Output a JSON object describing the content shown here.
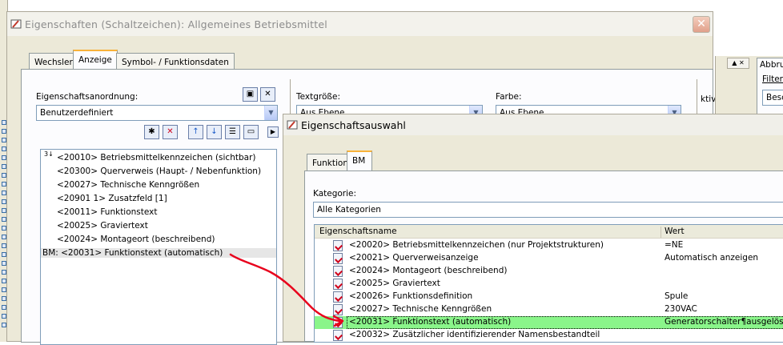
{
  "main_dialog": {
    "title": "Eigenschaften (Schaltzeichen): Allgemeines Betriebsmittel",
    "tabs": [
      {
        "label": "Wechsler",
        "active": false
      },
      {
        "label": "Anzeige",
        "active": true
      },
      {
        "label": "Symbol- / Funktionsdaten",
        "active": false
      }
    ],
    "arrangement_label": "Eigenschaftsanordnung:",
    "arrangement_value": "Benutzerdefiniert",
    "textsize_label": "Textgröße:",
    "textsize_value": "Aus Ebene",
    "color_label": "Farbe:",
    "color_value": "Aus Ebene",
    "partial_right_label": "ktiv",
    "properties": [
      "<20010> Betriebsmittelkennzeichen (sichtbar)",
      "<20300> Querverweis (Haupt- / Nebenfunktion)",
      "<20027> Technische Kenngrößen",
      "<20901 1> Zusatzfeld [1]",
      "<20011> Funktionstext",
      "<20025> Graviertext",
      "<20024> Montageort (beschreibend)",
      "BM: <20031> Funktionstext (automatisch)"
    ],
    "sort_glyph": "3↓"
  },
  "side_window": {
    "tab": "Abbru",
    "filter_label": "Filter",
    "field_value": "Besc"
  },
  "selection_dialog": {
    "title": "Eigenschaftsauswahl",
    "tabs": [
      {
        "label": "Funktion",
        "active": false
      },
      {
        "label": "BM",
        "active": true
      }
    ],
    "category_label": "Kategorie:",
    "category_value": "Alle Kategorien",
    "columns": [
      "Eigenschaftsname",
      "Wert"
    ],
    "rows": [
      {
        "name": "<20020> Betriebsmittelkennzeichen (nur Projektstrukturen)",
        "value": "=NE",
        "selected": false
      },
      {
        "name": "<20021> Querverweisanzeige",
        "value": "Automatisch anzeigen",
        "selected": false
      },
      {
        "name": "<20024> Montageort (beschreibend)",
        "value": "",
        "selected": false
      },
      {
        "name": "<20025> Graviertext",
        "value": "",
        "selected": false
      },
      {
        "name": "<20026> Funktionsdefinition",
        "value": "Spule",
        "selected": false
      },
      {
        "name": "<20027> Technische Kenngrößen",
        "value": "230VAC",
        "selected": false
      },
      {
        "name": "<20031> Funktionstext (automatisch)",
        "value": "Generatorschalter¶ausgelöst",
        "selected": true
      },
      {
        "name": "<20032> Zusätzlicher identifizierender Namensbestandteil",
        "value": "",
        "selected": false
      }
    ]
  },
  "colors": {
    "selection_highlight": "#8af58a",
    "annotation_arrow": "#e8001c",
    "tab_accent": "#f8b23a"
  }
}
